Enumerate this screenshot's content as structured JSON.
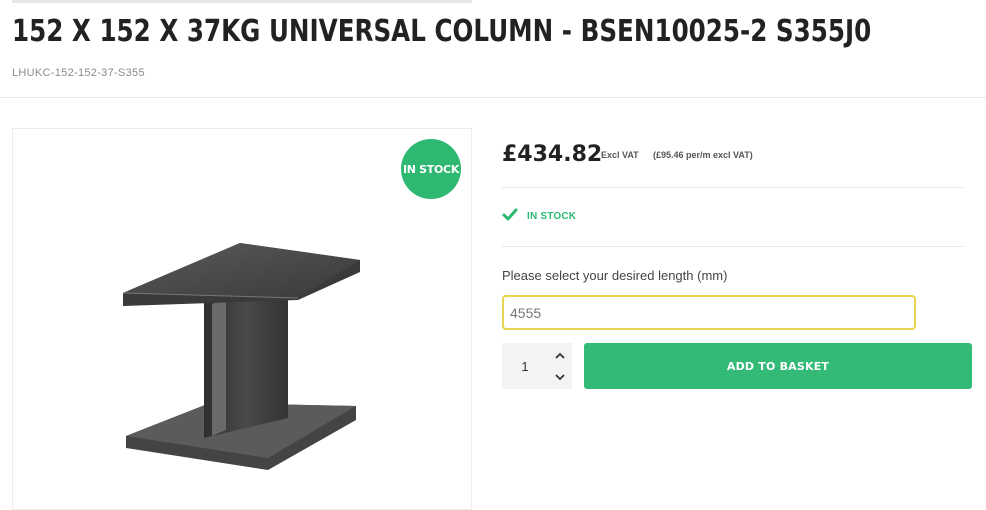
{
  "product": {
    "title": "152 X 152 X 37KG UNIVERSAL COLUMN - BSEN10025-2 S355J0",
    "sku": "LHUKC-152-152-37-S355",
    "badge": "IN STOCK",
    "image_icon": "steel-i-beam"
  },
  "pricing": {
    "price": "£434.82",
    "vat_label": "Excl VAT",
    "per_meter": "(£95.46 per/m excl VAT)"
  },
  "stock": {
    "icon": "check-icon",
    "label": "IN STOCK",
    "color": "#2eb872"
  },
  "length": {
    "label": "Please select your desired length (mm)",
    "value": "4555"
  },
  "quantity": {
    "value": "1"
  },
  "basket": {
    "button_label": "ADD TO BASKET",
    "color": "#34ba77"
  }
}
